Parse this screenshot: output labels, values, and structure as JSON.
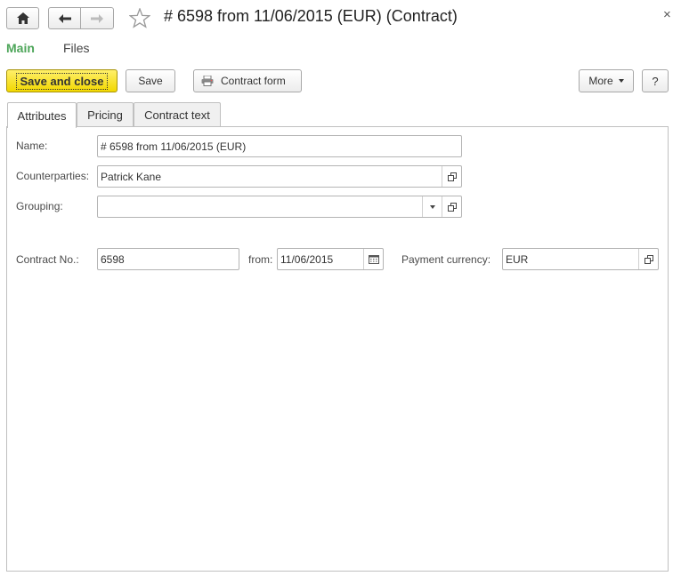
{
  "window": {
    "title": "# 6598 from 11/06/2015 (EUR) (Contract)",
    "close_glyph": "×"
  },
  "nav": {
    "home_icon": "home-icon",
    "back_icon": "arrow-left-icon",
    "forward_icon": "arrow-right-icon",
    "favorite_icon": "star-icon"
  },
  "sections": [
    {
      "label": "Main",
      "active": true
    },
    {
      "label": "Files",
      "active": false
    }
  ],
  "toolbar": {
    "save_and_close": "Save and close",
    "save": "Save",
    "contract_form": "Contract form",
    "more": "More",
    "help": "?"
  },
  "tabs": [
    {
      "label": "Attributes",
      "active": true
    },
    {
      "label": "Pricing",
      "active": false
    },
    {
      "label": "Contract text",
      "active": false
    }
  ],
  "form": {
    "name": {
      "label": "Name:",
      "value": "# 6598 from 11/06/2015 (EUR)"
    },
    "counterparties": {
      "label": "Counterparties:",
      "value": "Patrick Kane"
    },
    "grouping": {
      "label": "Grouping:",
      "value": ""
    },
    "contract_no": {
      "label": "Contract No.:",
      "value": "6598"
    },
    "from": {
      "label": "from:",
      "value": "11/06/2015"
    },
    "payment_currency": {
      "label": "Payment currency:",
      "value": "EUR"
    }
  },
  "colors": {
    "accent_green": "#4ea65a",
    "primary_yellow": "#f5dc00"
  }
}
